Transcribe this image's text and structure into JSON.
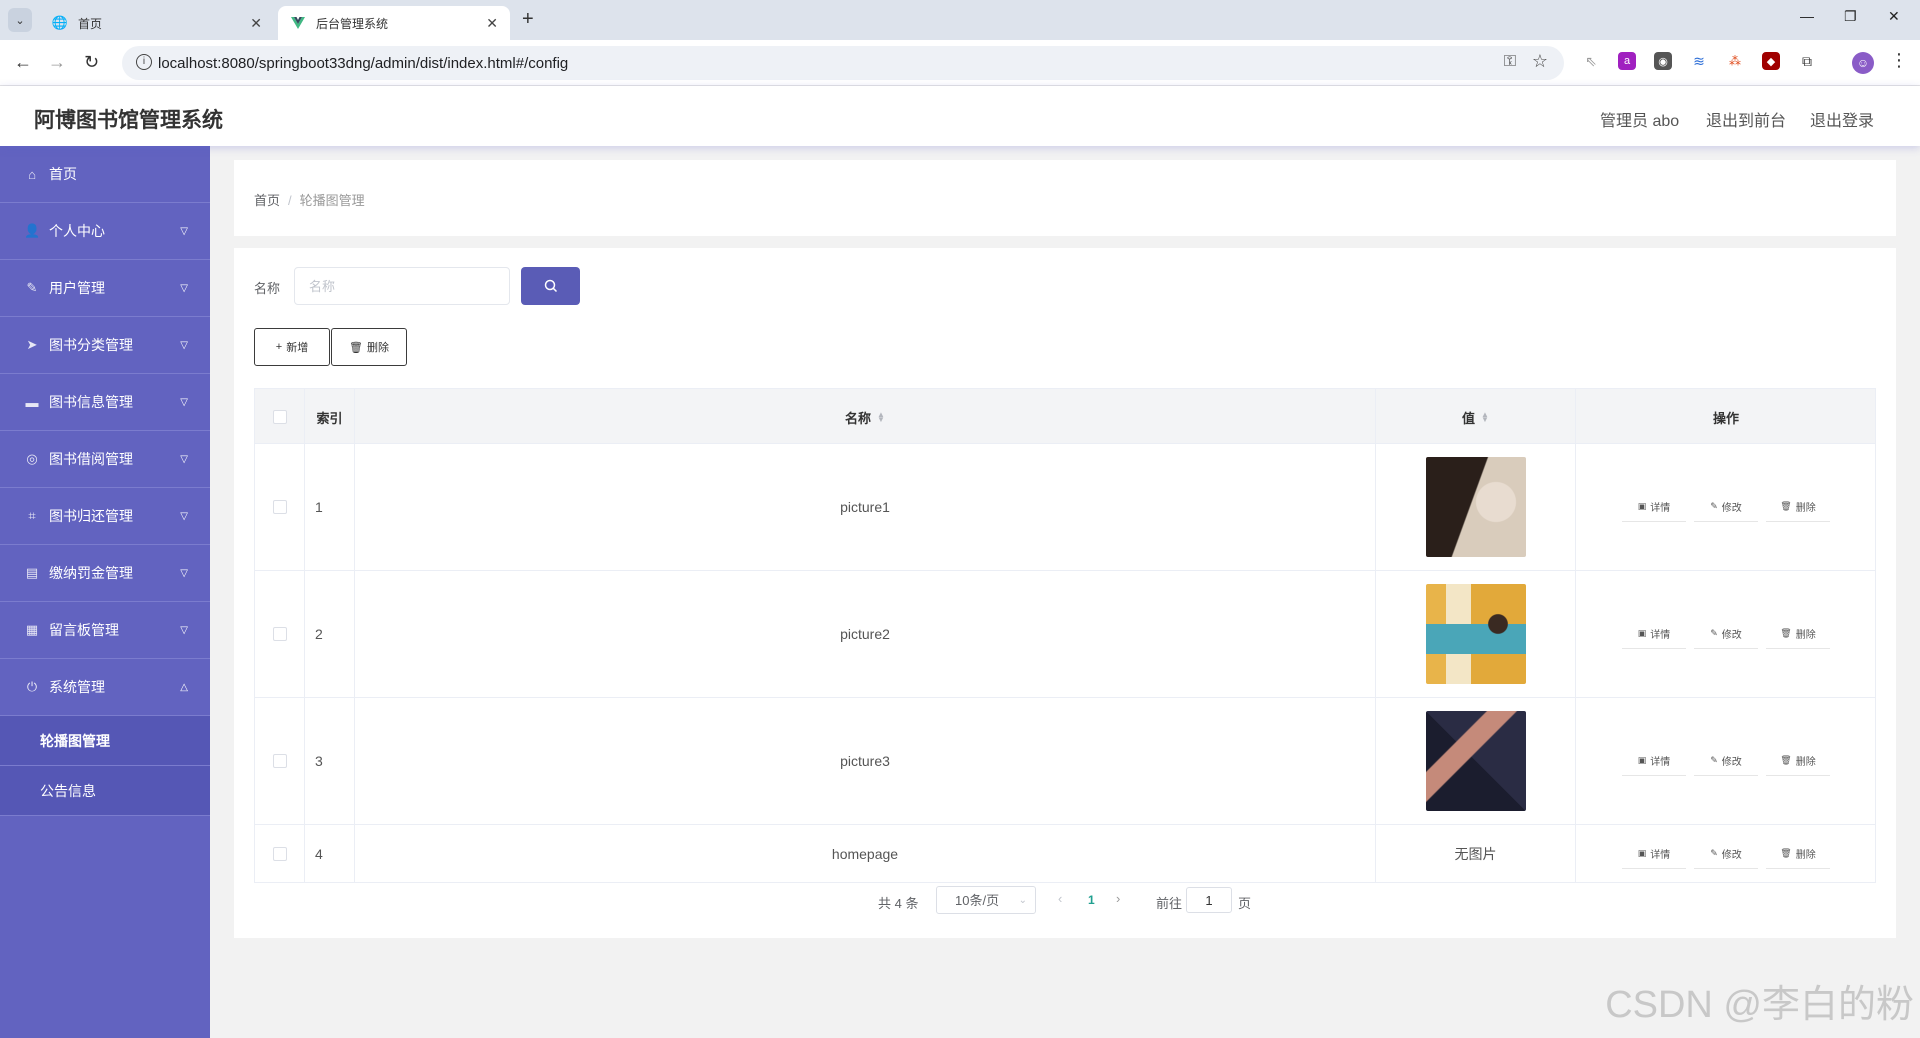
{
  "browser": {
    "tabs": [
      {
        "title": "首页",
        "icon": "globe-icon"
      },
      {
        "title": "后台管理系统",
        "icon": "vue-logo-icon"
      }
    ],
    "url": "localhost:8080/springboot33dng/admin/dist/index.html#/config"
  },
  "header": {
    "title": "阿博图书馆管理系统",
    "user": "管理员 abo",
    "to_front": "退出到前台",
    "logout": "退出登录"
  },
  "sidebar": {
    "items": [
      {
        "label": "首页",
        "icon": "home-icon"
      },
      {
        "label": "个人中心",
        "icon": "user-icon"
      },
      {
        "label": "用户管理",
        "icon": "edit-icon"
      },
      {
        "label": "图书分类管理",
        "icon": "send-icon"
      },
      {
        "label": "图书信息管理",
        "icon": "message-icon"
      },
      {
        "label": "图书借阅管理",
        "icon": "globe-icon"
      },
      {
        "label": "图书归还管理",
        "icon": "crop-icon"
      },
      {
        "label": "缴纳罚金管理",
        "icon": "list-icon"
      },
      {
        "label": "留言板管理",
        "icon": "grid-icon"
      },
      {
        "label": "系统管理",
        "icon": "power-icon"
      }
    ],
    "sub_items": [
      "轮播图管理",
      "公告信息"
    ]
  },
  "breadcrumb": {
    "home": "首页",
    "current": "轮播图管理"
  },
  "search": {
    "label": "名称",
    "placeholder": "名称"
  },
  "actions": {
    "add": "新增",
    "delete": "删除"
  },
  "table": {
    "headers": {
      "index": "索引",
      "name": "名称",
      "value": "值",
      "ops": "操作"
    },
    "rows": [
      {
        "index": "1",
        "name": "picture1",
        "value": "image"
      },
      {
        "index": "2",
        "name": "picture2",
        "value": "image"
      },
      {
        "index": "3",
        "name": "picture3",
        "value": "image"
      },
      {
        "index": "4",
        "name": "homepage",
        "value": "无图片"
      }
    ],
    "ops": {
      "detail": "详情",
      "edit": "修改",
      "delete": "删除"
    }
  },
  "pagination": {
    "total": "共 4 条",
    "page_size": "10条/页",
    "current": "1",
    "goto": "前往",
    "goto_value": "1",
    "page_suffix": "页"
  },
  "watermark": "CSDN @李白的粉",
  "colors": {
    "sidebar": "#6263c0",
    "accent": "#5a5cb6",
    "page_active": "#20a090"
  }
}
